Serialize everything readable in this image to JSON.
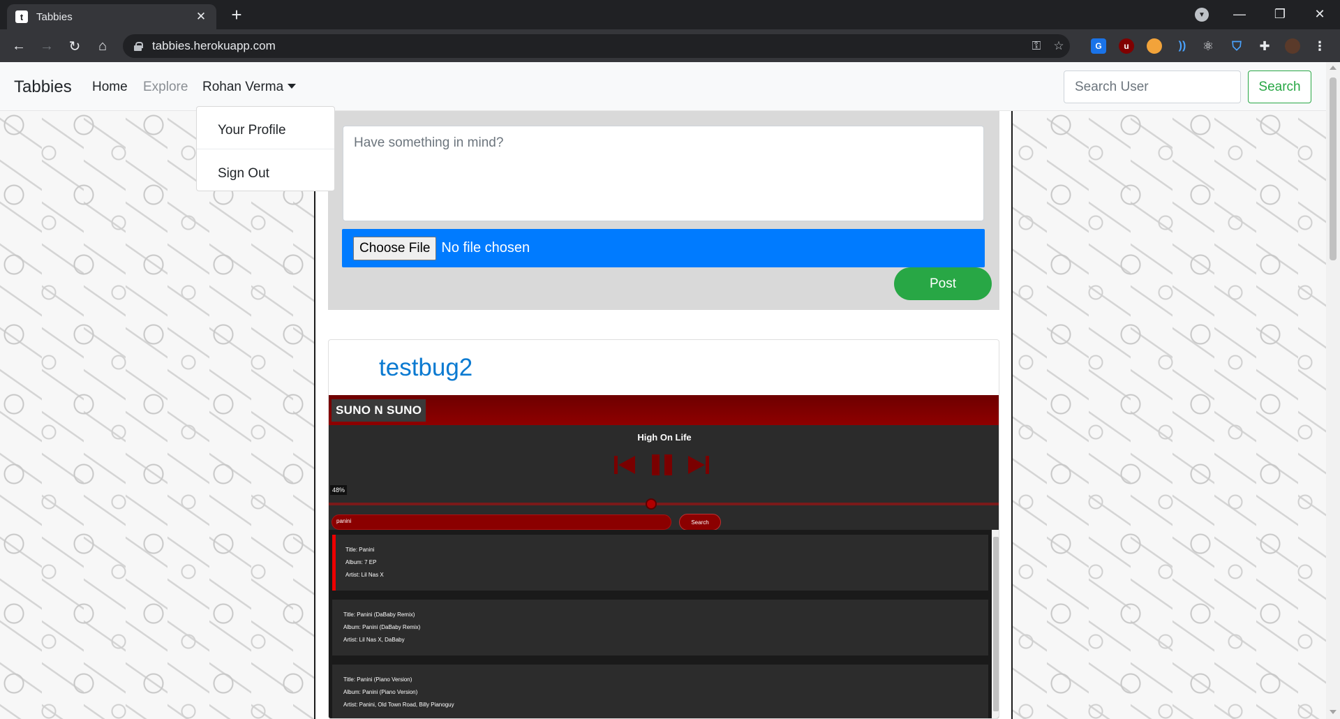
{
  "browser": {
    "tab_title": "Tabbies",
    "tab_favicon_letter": "t",
    "tab_close": "✕",
    "new_tab": "+",
    "url": "tabbies.herokuapp.com"
  },
  "navbar": {
    "brand": "Tabbies",
    "links": [
      "Home",
      "Explore"
    ],
    "user_menu": "Rohan Verma",
    "search_placeholder": "Search User",
    "search_button": "Search"
  },
  "dropdown": {
    "items": [
      "Your Profile",
      "Sign Out"
    ]
  },
  "composer": {
    "placeholder": "Have something in mind?",
    "choose_file": "Choose File",
    "no_file": "No file chosen",
    "post_button": "Post"
  },
  "post": {
    "username": "testbug2",
    "player": {
      "logo": "SUNO N SUNO",
      "song_title": "High On Life",
      "progress_label": "48%",
      "progress": 0.48,
      "search_value": "panini",
      "search_button": "Search",
      "results": [
        {
          "title": "Title: Panini",
          "album": "Album: 7 EP",
          "artist": "Artist: Lil Nas X",
          "active": true
        },
        {
          "title": "Title: Panini (DaBaby Remix)",
          "album": "Album: Panini (DaBaby Remix)",
          "artist": "Artist: Lil Nas X, DaBaby",
          "active": false
        },
        {
          "title": "Title: Panini (Piano Version)",
          "album": "Album: Panini (Piano Version)",
          "artist": "Artist: Panini, Old Town Road, Billy Pianoguy",
          "active": false
        }
      ]
    }
  },
  "colors": {
    "accent_primary": "#007bff",
    "accent_success": "#28a745",
    "username_link": "#0b7ad1",
    "player_red": "#8b0000"
  }
}
